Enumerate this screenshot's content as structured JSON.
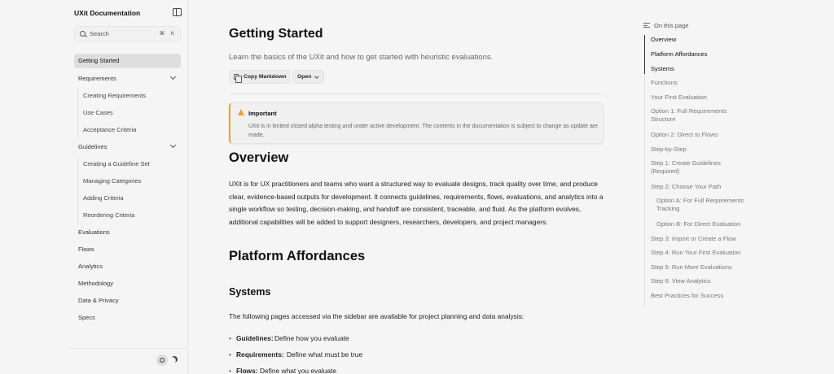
{
  "sidebar": {
    "title": "UXit Documentation",
    "search": {
      "placeholder": "Search",
      "kbd_cmd": "⌘",
      "kbd_key": "K"
    },
    "items": [
      {
        "label": "Getting Started"
      },
      {
        "label": "Requirements"
      },
      {
        "label": "Creating Requirements"
      },
      {
        "label": "Use Cases"
      },
      {
        "label": "Acceptance Criteria"
      },
      {
        "label": "Guidelines"
      },
      {
        "label": "Creating a Guideline Set"
      },
      {
        "label": "Managing Categories"
      },
      {
        "label": "Adding Criteria"
      },
      {
        "label": "Reordering Criteria"
      },
      {
        "label": "Evaluations"
      },
      {
        "label": "Flows"
      },
      {
        "label": "Analytics"
      },
      {
        "label": "Methodology"
      },
      {
        "label": "Data & Privacy"
      },
      {
        "label": "Specs"
      }
    ]
  },
  "main": {
    "title": "Getting Started",
    "description": "Learn the basics of the UXit and how to get started with heuristic evaluations.",
    "copy_label": "Copy Markdown",
    "open_label": "Open",
    "callout": {
      "title": "Important",
      "body": "UXit is in limited closed alpha testing and under active development. The contents in the documentation is subject to change as update are made."
    },
    "overview_heading": "Overview",
    "overview_text": "UXit is for UX practitioners and teams who want a structured way to evaluate designs, track quality over time, and produce clear, evidence-based outputs for development. It connects guidelines, requirements, flows, evaluations, and analytics into a single workflow so testing, decision-making, and handoff are consistent, traceable, and fluid. As the platform evolves, additional capabilities will be added to support designers, researchers, developers, and project managers.",
    "affordances_heading": "Platform Affordances",
    "systems_heading": "Systems",
    "systems_intro": "The following pages accessed via the sidebar are available for project planning and data analysis:",
    "bullets": [
      {
        "term": "Guidelines:",
        "desc": "Define how you evaluate"
      },
      {
        "term": "Requirements:",
        "desc": "Define what must be true"
      },
      {
        "term": "Flows:",
        "desc": "Define what you evaluate"
      }
    ]
  },
  "toc": {
    "heading": "On this page",
    "items": [
      "Overview",
      "Platform Affordances",
      "Systems",
      "Functions",
      "Your First Evaluation",
      "Option 1: Full Requirements Structure",
      "Option 2: Direct to Flows",
      "Step-by-Step",
      "Step 1: Create Guidelines (Required)",
      "Step 2: Choose Your Path",
      "Option A: For Full Requirements Tracking",
      "Option B: For Direct Evaluation",
      "Step 3: Import or Create a Flow",
      "Step 4: Run Your First Evaluation",
      "Step 5: Run More Evaluations",
      "Step 6: View Analytics",
      "Best Practices for Success"
    ]
  },
  "colors": {
    "accent_warning": "#e2a33a",
    "active_nav_bg": "#dedede",
    "page_bg": "#f5f5f5"
  }
}
